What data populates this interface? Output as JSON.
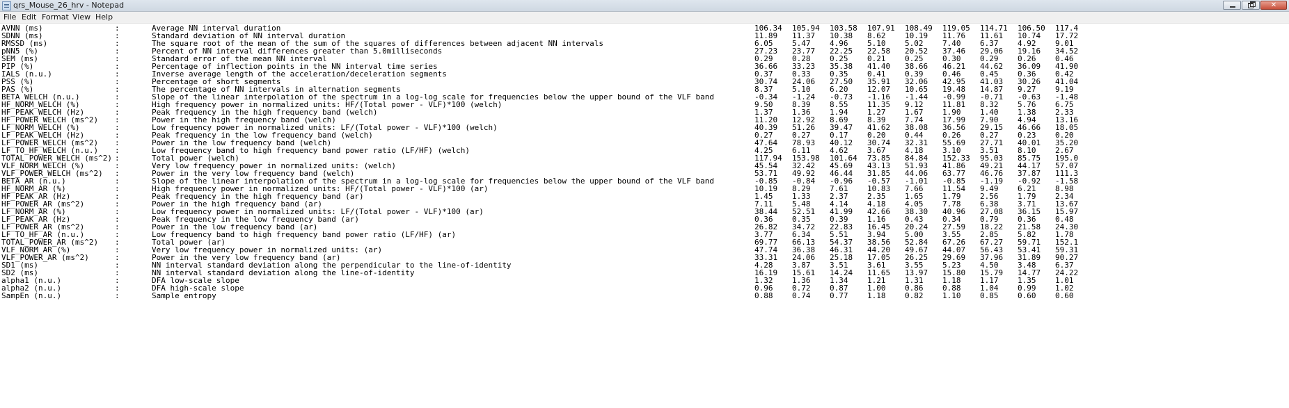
{
  "window": {
    "title": "qrs_Mouse_26_hrv - Notepad"
  },
  "menu": [
    "File",
    "Edit",
    "Format",
    "View",
    "Help"
  ],
  "rows": [
    {
      "name": "AVNN (ms)",
      "sep": ":",
      "desc": "Average NN interval duration",
      "values": [
        "106.34",
        "105.94",
        "103.58",
        "107.91",
        "108.49",
        "119.05",
        "114.71",
        "106.50",
        "117.4"
      ]
    },
    {
      "name": "SDNN (ms)",
      "sep": ":",
      "desc": "Standard deviation of NN interval duration",
      "values": [
        "11.89",
        "11.37",
        "10.38",
        "8.62",
        "10.19",
        "11.76",
        "11.61",
        "10.74",
        "17.72"
      ]
    },
    {
      "name": "RMSSD (ms)",
      "sep": ":",
      "desc": "The square root of the mean of the sum of the squares of differences between adjacent NN intervals",
      "values": [
        "6.05",
        "5.47",
        "4.96",
        "5.10",
        "5.02",
        "7.40",
        "6.37",
        "4.92",
        "9.01"
      ]
    },
    {
      "name": "pNN5 (%)",
      "sep": ":",
      "desc": "Percent of NN interval differences greater than 5.0milliseconds",
      "values": [
        "27.23",
        "23.77",
        "22.25",
        "22.58",
        "20.52",
        "37.46",
        "29.06",
        "19.16",
        "34.52"
      ]
    },
    {
      "name": "SEM (ms)",
      "sep": ":",
      "desc": "Standard error of the mean NN interval",
      "values": [
        "0.29",
        "0.28",
        "0.25",
        "0.21",
        "0.25",
        "0.30",
        "0.29",
        "0.26",
        "0.46"
      ]
    },
    {
      "name": "PIP (%)",
      "sep": ":",
      "desc": "Percentage of inflection points in the NN interval time series",
      "values": [
        "36.66",
        "33.23",
        "35.38",
        "41.40",
        "38.66",
        "46.21",
        "44.62",
        "36.09",
        "41.90"
      ]
    },
    {
      "name": "IALS (n.u.)",
      "sep": ":",
      "desc": "Inverse average length of the acceleration/deceleration segments",
      "values": [
        "0.37",
        "0.33",
        "0.35",
        "0.41",
        "0.39",
        "0.46",
        "0.45",
        "0.36",
        "0.42"
      ]
    },
    {
      "name": "PSS (%)",
      "sep": ":",
      "desc": "Percentage of short segments",
      "values": [
        "30.74",
        "24.06",
        "27.50",
        "35.91",
        "32.06",
        "42.95",
        "41.03",
        "30.26",
        "41.04"
      ]
    },
    {
      "name": "PAS (%)",
      "sep": ":",
      "desc": "The percentage of NN intervals in alternation segments",
      "values": [
        "8.37",
        "5.10",
        "6.20",
        "12.07",
        "10.65",
        "19.48",
        "14.87",
        "9.27",
        "9.19"
      ]
    },
    {
      "name": "BETA_WELCH (n.u.)",
      "sep": ":",
      "desc": "Slope of the linear interpolation of the spectrum in a log-log scale for frequencies below the upper bound of the VLF band",
      "values": [
        "-0.34",
        "-1.24",
        "-0.73",
        "-1.16",
        "-1.44",
        "-0.99",
        "-0.71",
        "-0.63",
        "-1.48"
      ]
    },
    {
      "name": "HF_NORM_WELCH (%)",
      "sep": ":",
      "desc": "High frequency power in normalized units: HF/(Total power - VLF)*100 (welch)",
      "values": [
        "9.50",
        "8.39",
        "8.55",
        "11.35",
        "9.12",
        "11.81",
        "8.32",
        "5.76",
        "6.75"
      ]
    },
    {
      "name": "HF_PEAK_WELCH (Hz)",
      "sep": ":",
      "desc": "Peak frequency in the high frequency band (welch)",
      "values": [
        "1.37",
        "1.36",
        "1.94",
        "1.27",
        "1.67",
        "1.90",
        "1.40",
        "1.38",
        "2.33"
      ]
    },
    {
      "name": "HF_POWER_WELCH (ms^2)",
      "sep": ":",
      "desc": "Power in the high frequency band (welch)",
      "values": [
        "11.20",
        "12.92",
        "8.69",
        "8.39",
        "7.74",
        "17.99",
        "7.90",
        "4.94",
        "13.16"
      ]
    },
    {
      "name": "LF_NORM_WELCH (%)",
      "sep": ":",
      "desc": "Low frequency power in normalized units: LF/(Total power - VLF)*100 (welch)",
      "values": [
        "40.39",
        "51.26",
        "39.47",
        "41.62",
        "38.08",
        "36.56",
        "29.15",
        "46.66",
        "18.05"
      ]
    },
    {
      "name": "LF_PEAK_WELCH (Hz)",
      "sep": ":",
      "desc": "Peak frequency in the low frequency band (welch)",
      "values": [
        "0.27",
        "0.27",
        "0.17",
        "0.20",
        "0.44",
        "0.26",
        "0.27",
        "0.23",
        "0.20"
      ]
    },
    {
      "name": "LF_POWER_WELCH (ms^2)",
      "sep": ":",
      "desc": "Power in the low frequency band (welch)",
      "values": [
        "47.64",
        "78.93",
        "40.12",
        "30.74",
        "32.31",
        "55.69",
        "27.71",
        "40.01",
        "35.20"
      ]
    },
    {
      "name": "LF_TO_HF_WELCH (n.u.)",
      "sep": ":",
      "desc": "Low frequency band to high frequency band power ratio (LF/HF) (welch)",
      "values": [
        "4.25",
        "6.11",
        "4.62",
        "3.67",
        "4.18",
        "3.10",
        "3.51",
        "8.10",
        "2.67"
      ]
    },
    {
      "name": "TOTAL_POWER_WELCH (ms^2)",
      "sep": ":",
      "desc": "Total power (welch)",
      "values": [
        "117.94",
        "153.98",
        "101.64",
        "73.85",
        "84.84",
        "152.33",
        "95.03",
        "85.75",
        "195.0"
      ]
    },
    {
      "name": "VLF_NORM_WELCH (%)",
      "sep": ":",
      "desc": "Very low frequency power in normalized units: (welch)",
      "values": [
        "45.54",
        "32.42",
        "45.69",
        "43.13",
        "51.93",
        "41.86",
        "49.21",
        "44.17",
        "57.07"
      ]
    },
    {
      "name": "VLF_POWER_WELCH (ms^2)",
      "sep": ":",
      "desc": "Power in the very low frequency band (welch)",
      "values": [
        "53.71",
        "49.92",
        "46.44",
        "31.85",
        "44.06",
        "63.77",
        "46.76",
        "37.87",
        "111.3"
      ]
    },
    {
      "name": "BETA_AR (n.u.)",
      "sep": ":",
      "desc": "Slope of the linear interpolation of the spectrum in a log-log scale for frequencies below the upper bound of the VLF band",
      "values": [
        "-0.85",
        "-0.84",
        "-0.96",
        "-0.57",
        "-1.01",
        "-0.85",
        "-1.19",
        "-0.92",
        "-1.58"
      ]
    },
    {
      "name": "HF_NORM_AR (%)",
      "sep": ":",
      "desc": "High frequency power in normalized units: HF/(Total power - VLF)*100 (ar)",
      "values": [
        "10.19",
        "8.29",
        "7.61",
        "10.83",
        "7.66",
        "11.54",
        "9.49",
        "6.21",
        "8.98"
      ]
    },
    {
      "name": "HF_PEAK_AR (Hz)",
      "sep": ":",
      "desc": "Peak frequency in the high frequency band (ar)",
      "values": [
        "1.45",
        "1.33",
        "2.37",
        "2.35",
        "1.65",
        "1.79",
        "2.56",
        "1.79",
        "2.34"
      ]
    },
    {
      "name": "HF_POWER_AR (ms^2)",
      "sep": ":",
      "desc": "Power in the high frequency band (ar)",
      "values": [
        "7.11",
        "5.48",
        "4.14",
        "4.18",
        "4.05",
        "7.78",
        "6.38",
        "3.71",
        "13.67"
      ]
    },
    {
      "name": "LF_NORM_AR (%)",
      "sep": ":",
      "desc": "Low frequency power in normalized units: LF/(Total power - VLF)*100 (ar)",
      "values": [
        "38.44",
        "52.51",
        "41.99",
        "42.66",
        "38.30",
        "40.96",
        "27.08",
        "36.15",
        "15.97"
      ]
    },
    {
      "name": "LF_PEAK_AR (Hz)",
      "sep": ":",
      "desc": "Peak frequency in the low frequency band (ar)",
      "values": [
        "0.36",
        "0.35",
        "0.39",
        "1.16",
        "0.43",
        "0.34",
        "0.79",
        "0.36",
        "0.48"
      ]
    },
    {
      "name": "LF_POWER_AR (ms^2)",
      "sep": ":",
      "desc": "Power in the low frequency band (ar)",
      "values": [
        "26.82",
        "34.72",
        "22.83",
        "16.45",
        "20.24",
        "27.59",
        "18.22",
        "21.58",
        "24.30"
      ]
    },
    {
      "name": "LF_TO_HF_AR (n.u.)",
      "sep": ":",
      "desc": "Low frequency band to high frequency band power ratio (LF/HF) (ar)",
      "values": [
        "3.77",
        "6.34",
        "5.51",
        "3.94",
        "5.00",
        "3.55",
        "2.85",
        "5.82",
        "1.78"
      ]
    },
    {
      "name": "TOTAL_POWER_AR (ms^2)",
      "sep": ":",
      "desc": "Total power (ar)",
      "values": [
        "69.77",
        "66.13",
        "54.37",
        "38.56",
        "52.84",
        "67.26",
        "67.27",
        "59.71",
        "152.1"
      ]
    },
    {
      "name": "VLF_NORM_AR (%)",
      "sep": ":",
      "desc": "Very low frequency power in normalized units: (ar)",
      "values": [
        "47.74",
        "36.38",
        "46.31",
        "44.20",
        "49.67",
        "44.07",
        "56.43",
        "53.41",
        "59.31"
      ]
    },
    {
      "name": "VLF_POWER_AR (ms^2)",
      "sep": ":",
      "desc": "Power in the very low frequency band (ar)",
      "values": [
        "33.31",
        "24.06",
        "25.18",
        "17.05",
        "26.25",
        "29.69",
        "37.96",
        "31.89",
        "90.27"
      ]
    },
    {
      "name": "SD1 (ms)",
      "sep": ":",
      "desc": "NN interval standard deviation along the perpendicular to the line-of-identity",
      "values": [
        "4.28",
        "3.87",
        "3.51",
        "3.61",
        "3.55",
        "5.23",
        "4.50",
        "3.48",
        "6.37"
      ]
    },
    {
      "name": "SD2 (ms)",
      "sep": ":",
      "desc": "NN interval standard deviation along the line-of-identity",
      "values": [
        "16.19",
        "15.61",
        "14.24",
        "11.65",
        "13.97",
        "15.80",
        "15.79",
        "14.77",
        "24.22"
      ]
    },
    {
      "name": "alpha1 (n.u.)",
      "sep": ":",
      "desc": "DFA low-scale slope",
      "values": [
        "1.32",
        "1.36",
        "1.34",
        "1.21",
        "1.31",
        "1.18",
        "1.17",
        "1.35",
        "1.01"
      ]
    },
    {
      "name": "alpha2 (n.u.)",
      "sep": ":",
      "desc": "DFA high-scale slope",
      "values": [
        "0.96",
        "0.72",
        "0.87",
        "1.00",
        "0.86",
        "0.88",
        "1.04",
        "0.99",
        "1.02"
      ]
    },
    {
      "name": "SampEn (n.u.)",
      "sep": ":",
      "desc": "Sample entropy",
      "values": [
        "0.88",
        "0.74",
        "0.77",
        "1.18",
        "0.82",
        "1.10",
        "0.85",
        "0.60",
        "0.60"
      ]
    }
  ]
}
